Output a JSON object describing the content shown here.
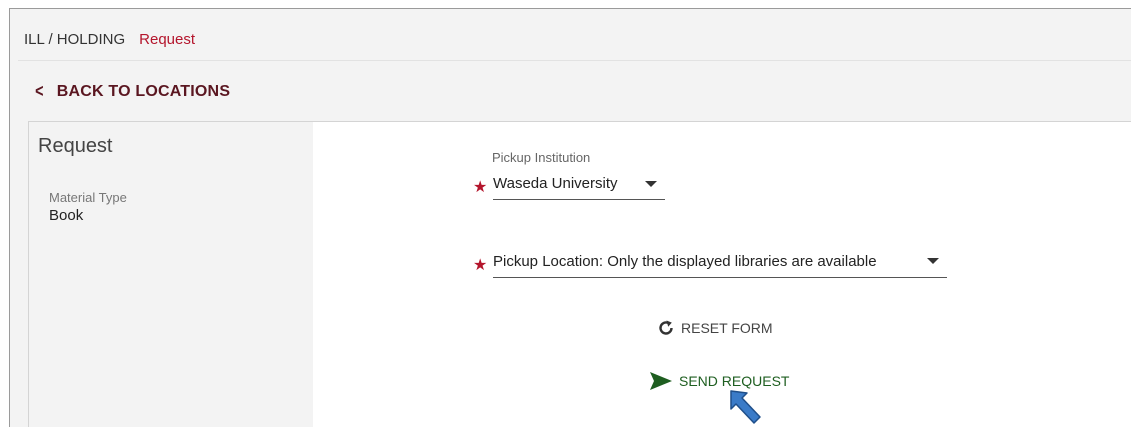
{
  "breadcrumb": {
    "parent": "ILL / HOLDING",
    "current": "Request"
  },
  "back_label": "BACK TO LOCATIONS",
  "panel": {
    "title": "Request",
    "material_type_label": "Material Type",
    "material_type_value": "Book"
  },
  "form": {
    "pickup_institution_label": "Pickup Institution",
    "pickup_institution_value": "Waseda University",
    "pickup_location_value": "Pickup Location: Only the displayed libraries are available",
    "required_marker": "★",
    "reset_label": "RESET FORM",
    "send_label": "SEND REQUEST"
  },
  "colors": {
    "accent_red": "#b4152c",
    "back_link": "#5a1620",
    "send_green": "#1e5e20",
    "pointer_blue": "#3a7bc8"
  },
  "icons": {
    "back": "chevron-left-icon",
    "reset": "refresh-icon",
    "send": "paper-plane-icon",
    "annotation": "arrow-pointer-icon"
  }
}
